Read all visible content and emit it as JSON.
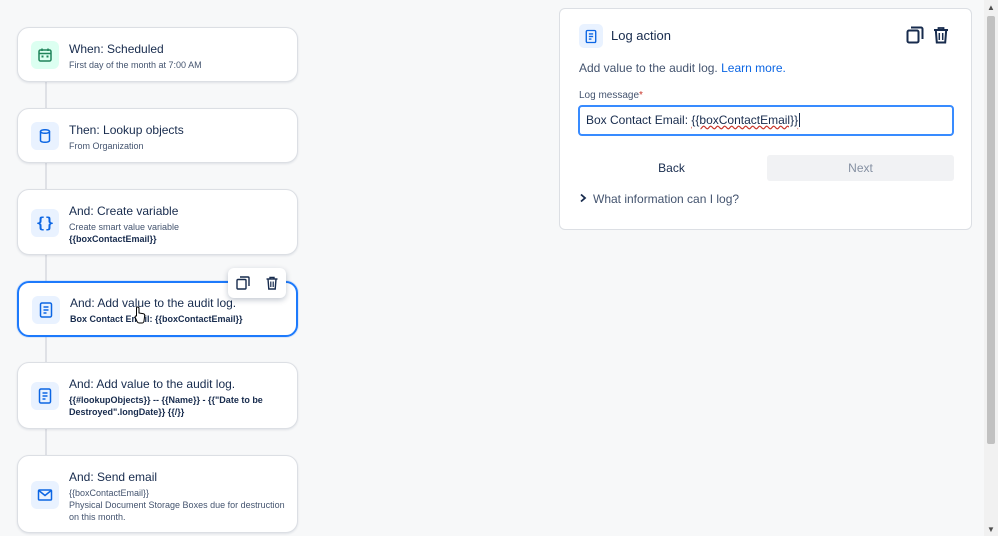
{
  "rules": [
    {
      "title": "When: Scheduled",
      "sub": "First day of the month at 7:00 AM",
      "icon": "calendar-icon"
    },
    {
      "title": "Then: Lookup objects",
      "sub": "From Organization",
      "icon": "database-icon"
    },
    {
      "title": "And: Create variable",
      "sub": "Create smart value variable",
      "sub_bold": "{{boxContactEmail}}",
      "icon": "braces-icon"
    },
    {
      "title": "And: Add value to the audit log.",
      "sub_bold": "Box Contact Email: {{boxContactEmail}}",
      "icon": "log-icon"
    },
    {
      "title": "And: Add value to the audit log.",
      "sub_bold": "{{#lookupObjects}} -- {{Name}} - {{\"Date to be Destroyed\".longDate}} {{/}}",
      "icon": "log-icon"
    },
    {
      "title": "And: Send email",
      "sub_lines": [
        "{{boxContactEmail}}",
        "Physical Document Storage Boxes due for destruction on this month."
      ],
      "icon": "mail-icon"
    }
  ],
  "panel": {
    "title": "Log action",
    "description": "Add value to the audit log.",
    "learn_more": "Learn more.",
    "field_label": "Log message",
    "required_mark": "*",
    "field_prefix": "Box Contact Email: ",
    "field_token": "{{boxContactEmail}}",
    "back_label": "Back",
    "next_label": "Next",
    "disclosure": "What information can I log?"
  },
  "icons": {
    "accent": "#0c66e4",
    "green": "#1f845a"
  }
}
